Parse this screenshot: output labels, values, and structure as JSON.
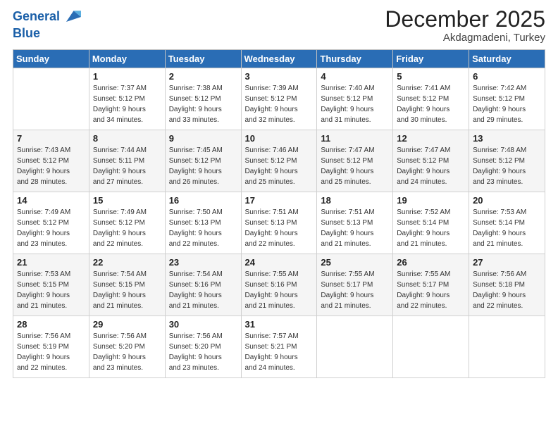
{
  "logo": {
    "line1": "General",
    "line2": "Blue"
  },
  "title": "December 2025",
  "subtitle": "Akdagmadeni, Turkey",
  "header_days": [
    "Sunday",
    "Monday",
    "Tuesday",
    "Wednesday",
    "Thursday",
    "Friday",
    "Saturday"
  ],
  "weeks": [
    [
      {
        "day": "",
        "info": ""
      },
      {
        "day": "1",
        "info": "Sunrise: 7:37 AM\nSunset: 5:12 PM\nDaylight: 9 hours\nand 34 minutes."
      },
      {
        "day": "2",
        "info": "Sunrise: 7:38 AM\nSunset: 5:12 PM\nDaylight: 9 hours\nand 33 minutes."
      },
      {
        "day": "3",
        "info": "Sunrise: 7:39 AM\nSunset: 5:12 PM\nDaylight: 9 hours\nand 32 minutes."
      },
      {
        "day": "4",
        "info": "Sunrise: 7:40 AM\nSunset: 5:12 PM\nDaylight: 9 hours\nand 31 minutes."
      },
      {
        "day": "5",
        "info": "Sunrise: 7:41 AM\nSunset: 5:12 PM\nDaylight: 9 hours\nand 30 minutes."
      },
      {
        "day": "6",
        "info": "Sunrise: 7:42 AM\nSunset: 5:12 PM\nDaylight: 9 hours\nand 29 minutes."
      }
    ],
    [
      {
        "day": "7",
        "info": "Sunrise: 7:43 AM\nSunset: 5:12 PM\nDaylight: 9 hours\nand 28 minutes."
      },
      {
        "day": "8",
        "info": "Sunrise: 7:44 AM\nSunset: 5:11 PM\nDaylight: 9 hours\nand 27 minutes."
      },
      {
        "day": "9",
        "info": "Sunrise: 7:45 AM\nSunset: 5:12 PM\nDaylight: 9 hours\nand 26 minutes."
      },
      {
        "day": "10",
        "info": "Sunrise: 7:46 AM\nSunset: 5:12 PM\nDaylight: 9 hours\nand 25 minutes."
      },
      {
        "day": "11",
        "info": "Sunrise: 7:47 AM\nSunset: 5:12 PM\nDaylight: 9 hours\nand 25 minutes."
      },
      {
        "day": "12",
        "info": "Sunrise: 7:47 AM\nSunset: 5:12 PM\nDaylight: 9 hours\nand 24 minutes."
      },
      {
        "day": "13",
        "info": "Sunrise: 7:48 AM\nSunset: 5:12 PM\nDaylight: 9 hours\nand 23 minutes."
      }
    ],
    [
      {
        "day": "14",
        "info": "Sunrise: 7:49 AM\nSunset: 5:12 PM\nDaylight: 9 hours\nand 23 minutes."
      },
      {
        "day": "15",
        "info": "Sunrise: 7:49 AM\nSunset: 5:12 PM\nDaylight: 9 hours\nand 22 minutes."
      },
      {
        "day": "16",
        "info": "Sunrise: 7:50 AM\nSunset: 5:13 PM\nDaylight: 9 hours\nand 22 minutes."
      },
      {
        "day": "17",
        "info": "Sunrise: 7:51 AM\nSunset: 5:13 PM\nDaylight: 9 hours\nand 22 minutes."
      },
      {
        "day": "18",
        "info": "Sunrise: 7:51 AM\nSunset: 5:13 PM\nDaylight: 9 hours\nand 21 minutes."
      },
      {
        "day": "19",
        "info": "Sunrise: 7:52 AM\nSunset: 5:14 PM\nDaylight: 9 hours\nand 21 minutes."
      },
      {
        "day": "20",
        "info": "Sunrise: 7:53 AM\nSunset: 5:14 PM\nDaylight: 9 hours\nand 21 minutes."
      }
    ],
    [
      {
        "day": "21",
        "info": "Sunrise: 7:53 AM\nSunset: 5:15 PM\nDaylight: 9 hours\nand 21 minutes."
      },
      {
        "day": "22",
        "info": "Sunrise: 7:54 AM\nSunset: 5:15 PM\nDaylight: 9 hours\nand 21 minutes."
      },
      {
        "day": "23",
        "info": "Sunrise: 7:54 AM\nSunset: 5:16 PM\nDaylight: 9 hours\nand 21 minutes."
      },
      {
        "day": "24",
        "info": "Sunrise: 7:55 AM\nSunset: 5:16 PM\nDaylight: 9 hours\nand 21 minutes."
      },
      {
        "day": "25",
        "info": "Sunrise: 7:55 AM\nSunset: 5:17 PM\nDaylight: 9 hours\nand 21 minutes."
      },
      {
        "day": "26",
        "info": "Sunrise: 7:55 AM\nSunset: 5:17 PM\nDaylight: 9 hours\nand 22 minutes."
      },
      {
        "day": "27",
        "info": "Sunrise: 7:56 AM\nSunset: 5:18 PM\nDaylight: 9 hours\nand 22 minutes."
      }
    ],
    [
      {
        "day": "28",
        "info": "Sunrise: 7:56 AM\nSunset: 5:19 PM\nDaylight: 9 hours\nand 22 minutes."
      },
      {
        "day": "29",
        "info": "Sunrise: 7:56 AM\nSunset: 5:20 PM\nDaylight: 9 hours\nand 23 minutes."
      },
      {
        "day": "30",
        "info": "Sunrise: 7:56 AM\nSunset: 5:20 PM\nDaylight: 9 hours\nand 23 minutes."
      },
      {
        "day": "31",
        "info": "Sunrise: 7:57 AM\nSunset: 5:21 PM\nDaylight: 9 hours\nand 24 minutes."
      },
      {
        "day": "",
        "info": ""
      },
      {
        "day": "",
        "info": ""
      },
      {
        "day": "",
        "info": ""
      }
    ]
  ]
}
